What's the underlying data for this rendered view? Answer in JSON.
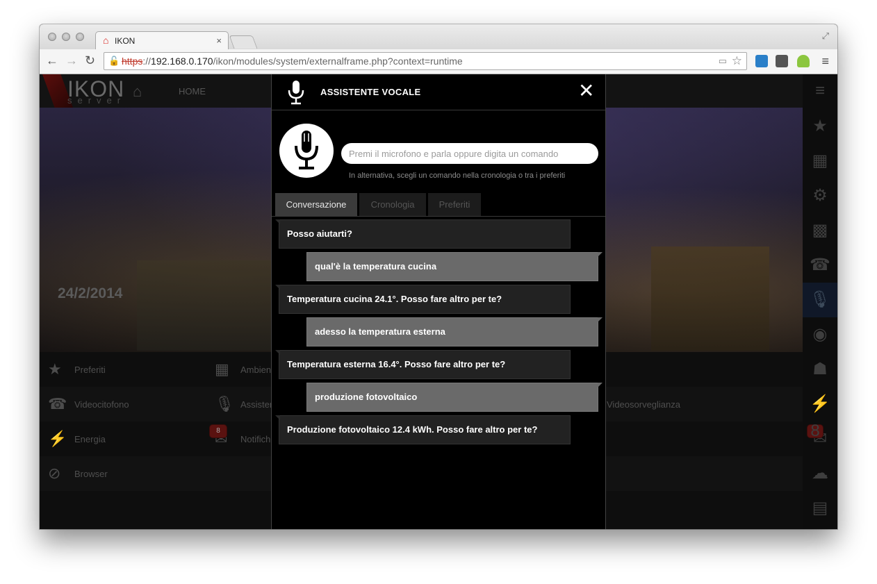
{
  "browser": {
    "tab_title": "IKON",
    "tab_close": "×",
    "url": {
      "scheme": "https",
      "sep": "://",
      "host": "192.168.0.170",
      "path": "/ikon/modules/system/externalframe.php?context=runtime"
    }
  },
  "app": {
    "logo_text": "IKON",
    "logo_sub": "server",
    "home_label": "HOME",
    "date": "24/2/2014",
    "grid": [
      [
        {
          "icon": "★",
          "label": "Preferiti"
        },
        {
          "icon": "▦",
          "label": "Ambienti"
        },
        null,
        null
      ],
      [
        {
          "icon": "☎",
          "label": "Videocitofono"
        },
        {
          "icon": "🎙",
          "label": "Assistente vocale"
        },
        null,
        {
          "icon": "",
          "label": "Videosorveglianza"
        }
      ],
      [
        {
          "icon": "⚡",
          "label": "Energia"
        },
        {
          "icon": "✉",
          "label": "Notifiche",
          "badge": "8"
        },
        null,
        null
      ],
      [
        {
          "icon": "⊘",
          "label": "Browser"
        },
        null,
        null,
        null
      ]
    ],
    "right_badge": "8"
  },
  "modal": {
    "title": "ASSISTENTE VOCALE",
    "close": "✕",
    "input_placeholder": "Premi il microfono e parla oppure digita un comando",
    "hint": "In alternativa, scegli un comando nella cronologia o tra i preferiti",
    "tabs": [
      {
        "label": "Conversazione",
        "active": true
      },
      {
        "label": "Cronologia",
        "active": false
      },
      {
        "label": "Preferiti",
        "active": false
      }
    ],
    "conversation": [
      {
        "from": "system",
        "text": "Posso aiutarti?"
      },
      {
        "from": "user",
        "text": "qual'è la temperatura cucina"
      },
      {
        "from": "system",
        "text": "Temperatura cucina 24.1°. Posso fare altro per te?"
      },
      {
        "from": "user",
        "text": "adesso la temperatura esterna"
      },
      {
        "from": "system",
        "text": "Temperatura esterna 16.4°. Posso fare altro per te?"
      },
      {
        "from": "user",
        "text": "produzione fotovoltaico"
      },
      {
        "from": "system",
        "text": "Produzione fotovoltaico 12.4 kWh. Posso fare altro per te?"
      }
    ]
  }
}
